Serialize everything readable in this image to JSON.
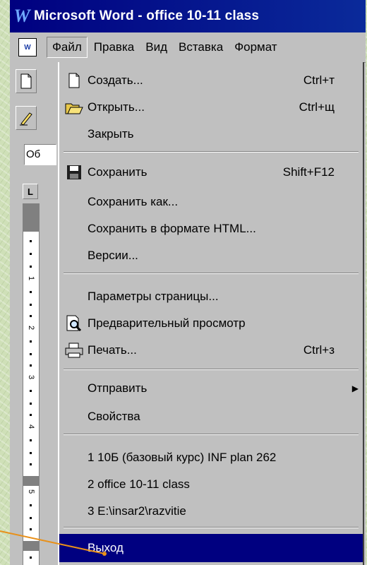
{
  "window": {
    "app_icon_glyph": "W",
    "title": "Microsoft Word - office 10-11 class"
  },
  "menubar": {
    "doc_icon_glyph": "W",
    "items": [
      {
        "label": "Файл",
        "active": true
      },
      {
        "label": "Правка"
      },
      {
        "label": "Вид"
      },
      {
        "label": "Вставка"
      },
      {
        "label": "Формат"
      }
    ]
  },
  "toolbar": {
    "style_box_value": "Об"
  },
  "ruler": {
    "corner_glyph": "L",
    "numbers": [
      "1",
      "2",
      "3",
      "4",
      "5"
    ]
  },
  "file_menu": {
    "items": [
      {
        "label": "Создать...",
        "shortcut": "Ctrl+т",
        "icon": "new-document-icon"
      },
      {
        "label": "Открыть...",
        "shortcut": "Ctrl+щ",
        "icon": "open-folder-icon"
      },
      {
        "label": "Закрыть"
      },
      {
        "label": "Сохранить",
        "shortcut": "Shift+F12",
        "icon": "save-disk-icon"
      },
      {
        "label": "Сохранить как..."
      },
      {
        "label": "Сохранить в формате HTML..."
      },
      {
        "label": "Версии..."
      },
      {
        "label": "Параметры страницы..."
      },
      {
        "label": "Предварительный просмотр",
        "icon": "print-preview-icon"
      },
      {
        "label": "Печать...",
        "shortcut": "Ctrl+з",
        "icon": "printer-icon"
      },
      {
        "label": "Отправить",
        "submenu": true
      },
      {
        "label": "Свойства"
      },
      {
        "label": "1 10Б (базовый курс) INF plan 262"
      },
      {
        "label": "2 office 10-11 class"
      },
      {
        "label": "3 E:\\insar2\\razvitie"
      },
      {
        "label": "Выход",
        "highlighted": true
      }
    ]
  },
  "colors": {
    "title_bar": "#000080",
    "highlight": "#000080",
    "pointer_line": "#e8901a",
    "background": "#cfe0b8"
  }
}
